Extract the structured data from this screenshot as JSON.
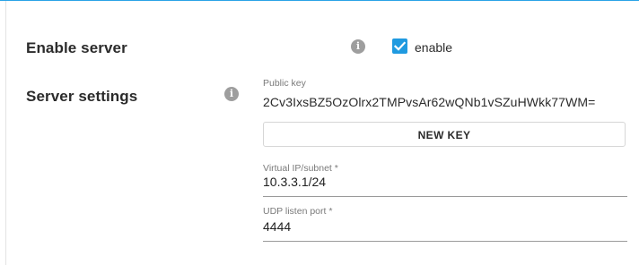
{
  "enable_server": {
    "label": "Enable server",
    "info_icon": "info-icon",
    "checkbox_checked": true,
    "checkbox_label": "enable",
    "accent_color": "#1f9ae0"
  },
  "server_settings": {
    "label": "Server settings",
    "info_icon": "info-icon",
    "public_key": {
      "caption": "Public key",
      "value": "2Cv3IxsBZ5OzOlrx2TMPvsAr62wQNb1vSZuHWkk77WM="
    },
    "new_key_button": "NEW KEY",
    "virtual_ip": {
      "caption": "Virtual IP/subnet *",
      "value": "10.3.3.1/24"
    },
    "udp_port": {
      "caption": "UDP listen port *",
      "value": "4444"
    }
  },
  "colors": {
    "top_border": "#2aa3e6"
  }
}
